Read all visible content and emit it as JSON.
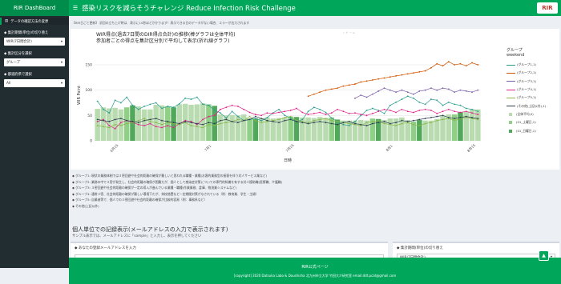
{
  "app": {
    "logo_label": "RIR DashBoard",
    "title": "感染リスクを減らそうチャレンジ Reduce Infection Risk Challenge",
    "brand_logo": "RIR"
  },
  "sidebar": {
    "item_label": "データの確認方法の変更",
    "period_label": "集計期間(単位)の切り替え",
    "period_value": "WIR(7日間合計)",
    "group_label": "集計区分を選択",
    "group_value": "グループ",
    "pref_label": "都道府県で選択",
    "pref_value": "All"
  },
  "notice": "【RIR日ごと更新】 初回の立ち上げ時は、表示に10秒ほどかかります！表示できる日のデータがない場合、エラーが出力されます",
  "chart_data": {
    "type": "line",
    "title_line1": "WIR得点(過去7日間のDIR得点合計)の推移(棒グラフは全体平均)",
    "title_line2": "参加者ごとの得点を集計区分別で平均して表示(折れ線グラフ)",
    "xlabel": "日時",
    "ylabel": "WIR Point",
    "yticks": [
      0,
      50,
      100,
      150
    ],
    "ylim": [
      0,
      180
    ],
    "xticks": [
      "6月15",
      "7月1",
      "7月15",
      "8月1",
      "8月15"
    ],
    "n_points": 66,
    "legend_title_line1": "グループ",
    "legend_title_line2": "weekend",
    "bar_series": [
      {
        "name": "(全体平均,0)",
        "color": "#b9dbb0"
      },
      {
        "name": "(01_土曜日,1)",
        "color": "#8fcf86"
      },
      {
        "name": "(01_日曜日,1)",
        "color": "#52a85a"
      }
    ],
    "bars": [
      63,
      66,
      64,
      65,
      62,
      66,
      70,
      68,
      62,
      62,
      71,
      70,
      68,
      66,
      72,
      73,
      71,
      72,
      74,
      72,
      69,
      52,
      50,
      51,
      50,
      52,
      44,
      44,
      45,
      46,
      44,
      45,
      46,
      48,
      47,
      46,
      46,
      45,
      47,
      45,
      46,
      42,
      40,
      40,
      40,
      41,
      40,
      44,
      43,
      41,
      44,
      44,
      46,
      41,
      38,
      41,
      40,
      40,
      43,
      50,
      52,
      52,
      56,
      58,
      62,
      62
    ],
    "bar_kinds": [
      0,
      0,
      0,
      0,
      0,
      1,
      2,
      0,
      0,
      0,
      0,
      0,
      1,
      2,
      0,
      0,
      0,
      0,
      0,
      1,
      2,
      0,
      0,
      0,
      0,
      0,
      1,
      2,
      0,
      0,
      0,
      0,
      0,
      1,
      2,
      0,
      0,
      0,
      0,
      0,
      1,
      2,
      0,
      0,
      0,
      0,
      0,
      1,
      2,
      0,
      0,
      0,
      0,
      0,
      1,
      2,
      0,
      0,
      0,
      0,
      0,
      1,
      2,
      0,
      0,
      0
    ],
    "series": [
      {
        "name": "(グループ1,1)",
        "color": "#2a9d8f",
        "values": [
          78,
          62,
          55,
          80,
          75,
          86,
          70,
          62,
          68,
          72,
          75,
          64,
          68,
          66,
          73,
          84,
          82,
          86,
          72,
          70,
          60,
          55,
          45,
          58,
          48,
          40,
          42,
          44,
          40,
          46,
          55,
          62,
          50,
          45,
          38,
          42,
          58,
          66,
          62,
          56,
          45,
          38,
          32,
          30,
          38,
          50,
          60,
          64,
          60,
          54,
          70,
          76,
          82,
          88,
          84,
          76,
          72,
          82,
          80,
          70,
          76,
          72,
          70,
          64,
          62,
          58
        ]
      },
      {
        "name": "(グループ2,1)",
        "color": "#d35400",
        "values": [
          null,
          null,
          null,
          null,
          null,
          null,
          null,
          null,
          null,
          null,
          null,
          null,
          null,
          null,
          null,
          null,
          null,
          null,
          null,
          null,
          null,
          null,
          null,
          null,
          null,
          null,
          null,
          null,
          null,
          null,
          null,
          null,
          null,
          null,
          null,
          null,
          88,
          92,
          96,
          100,
          102,
          104,
          108,
          110,
          112,
          116,
          118,
          120,
          122,
          124,
          126,
          128,
          130,
          132,
          134,
          136,
          138,
          144,
          152,
          148,
          156,
          150,
          152,
          148,
          154,
          150
        ]
      },
      {
        "name": "(グループ3,1)",
        "color": "#7b5ea7",
        "values": [
          null,
          null,
          null,
          null,
          null,
          null,
          null,
          null,
          null,
          null,
          null,
          null,
          null,
          null,
          null,
          null,
          null,
          null,
          null,
          null,
          null,
          null,
          null,
          null,
          null,
          null,
          null,
          null,
          null,
          null,
          null,
          null,
          null,
          null,
          null,
          null,
          null,
          null,
          null,
          null,
          null,
          null,
          null,
          null,
          84,
          90,
          86,
          92,
          98,
          104,
          100,
          96,
          100,
          96,
          92,
          98,
          100,
          104,
          100,
          104,
          102,
          96,
          100,
          98,
          96,
          100
        ]
      },
      {
        "name": "(グループ4,1)",
        "color": "#e0218a",
        "values": [
          38,
          42,
          30,
          24,
          36,
          40,
          36,
          32,
          30,
          34,
          28,
          26,
          30,
          26,
          34,
          40,
          38,
          32,
          42,
          48,
          50,
          62,
          66,
          70,
          68,
          62,
          56,
          52,
          50,
          55,
          54,
          56,
          58,
          60,
          64,
          56,
          52,
          54,
          56,
          52,
          55,
          62,
          58,
          54,
          55,
          52,
          50,
          54,
          58,
          62,
          60,
          56,
          62,
          58,
          56,
          60,
          62,
          60,
          54,
          58,
          62,
          58,
          56,
          58,
          55,
          52
        ]
      },
      {
        "name": "(グループ5,1)",
        "color": "#8ab84a",
        "values": [
          30,
          28,
          26,
          32,
          30,
          34,
          36,
          40,
          44,
          38,
          36,
          32,
          36,
          34,
          32,
          36,
          30,
          28,
          26,
          32,
          30,
          34,
          36,
          38,
          42,
          40,
          48,
          40,
          36,
          38,
          40,
          42,
          46,
          48,
          40,
          38,
          36,
          40,
          42,
          44,
          40,
          38,
          36,
          34,
          32,
          30,
          36,
          38,
          40,
          34,
          32,
          30,
          34,
          36,
          32,
          30,
          34,
          36,
          40,
          42,
          44,
          40,
          44,
          46,
          44,
          42
        ]
      },
      {
        "name": "(その他(上記以外),1)",
        "color": "#2c3e50",
        "values": [
          42,
          40,
          38,
          42,
          44,
          40,
          38,
          36,
          40,
          42,
          44,
          40,
          38,
          36,
          34,
          38,
          36,
          34,
          32,
          36,
          34,
          40,
          42,
          38,
          36,
          40,
          42,
          48,
          44,
          40,
          38,
          36,
          40,
          42,
          38,
          36,
          34,
          36,
          38,
          36,
          34,
          32,
          36,
          38,
          34,
          32,
          30,
          34,
          36,
          38,
          34,
          36,
          40,
          38,
          40,
          42,
          44,
          46,
          48,
          50,
          46,
          44,
          46,
          48,
          46,
          44
        ]
      }
    ]
  },
  "descriptions": [
    "◆ グループ1: 現状の業務体制では３密回避や社会的距離の確保が難しいと思われる職種・業種(お客的業務型の接客を伴う対人サービス業など)",
    "◆ グループ2: 業務の中で３密が発生し、社会的距離の確保が困難だが、個人として感染症対策についての専門的知識を有する対人援助職(医療職、介護職)",
    "◆ グループ3: ３密回避や社会的距離の確保が一定の導入が進んでいる業種・職種(作業業務、倉庫、物流業システムなど)",
    "◆ グループ4: 通常３密、社会的距離の確保が難しい環境下だが、休校措置など一定期間対策がなされている（例：教育業、学生・主婦）",
    "◆ グループ5: 自業者等で、個人での３密回避や社会的距離の確保が比較的容易（例：事務系など）",
    "◆ その他(上記以外)"
  ],
  "individual": {
    "title": "個人単位での記録表示(メールアドレスの入力で表示されます)",
    "subtitle": "サンプル表示では、メールアドレスに「sample」と入力し、表示を押してください",
    "email_label": "◆ あなたの登録メールアドレスを入力",
    "period_label": "◆ 集計期間(単位)の切り替え",
    "period_value": "WIR(7日間合計)"
  },
  "footer": {
    "line1": "RIR公式ページ",
    "line2": "[copyright] 2020 Datsuka Labo & Doushisha 北九州市立大学 竹田大介研究室 email:ddt.pcat@gmail.com"
  },
  "colors": {
    "header": "#00a65a",
    "logo_bg": "#008d4c",
    "sidebar": "#222d32"
  }
}
